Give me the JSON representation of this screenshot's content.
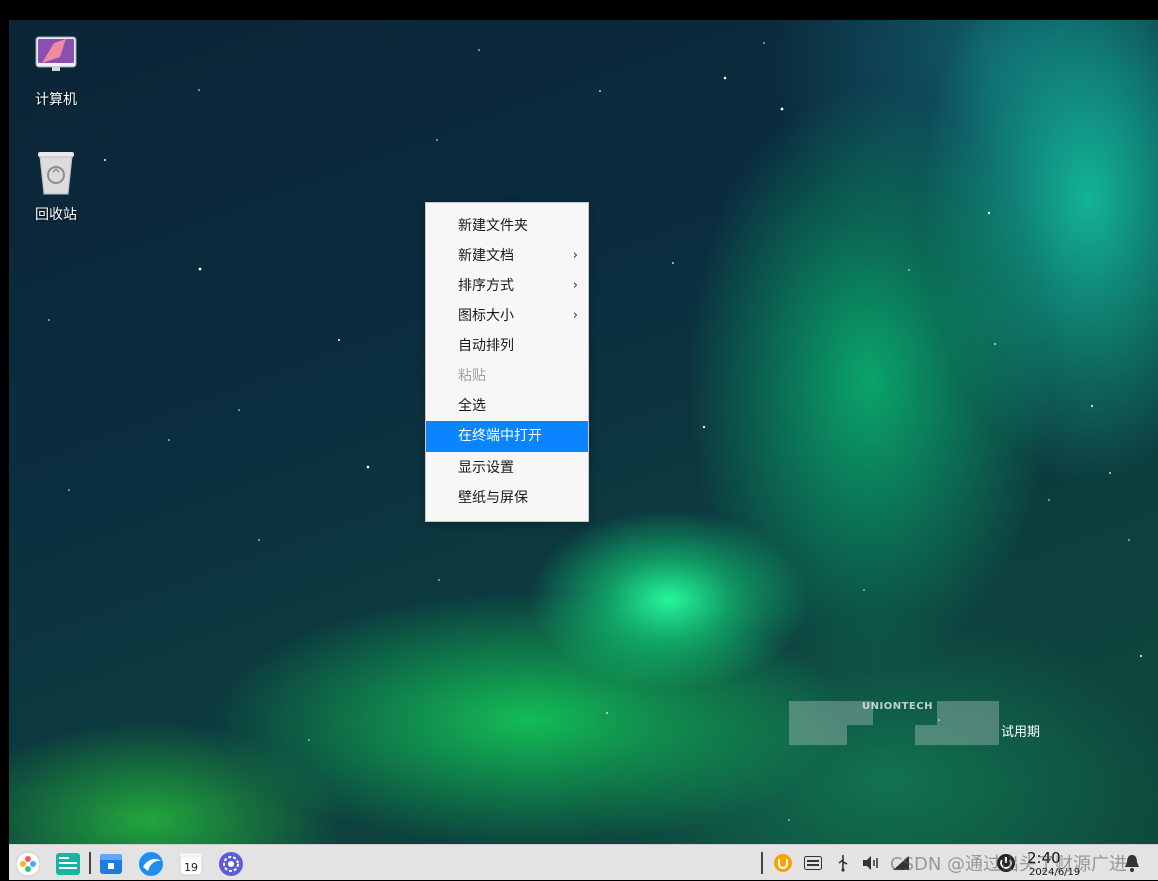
{
  "desktop": {
    "icons": [
      {
        "label": "计算机"
      },
      {
        "label": "回收站"
      }
    ]
  },
  "context_menu": {
    "items": [
      {
        "label": "新建文件夹"
      },
      {
        "label": "新建文档",
        "submenu": true
      },
      {
        "label": "排序方式",
        "submenu": true
      },
      {
        "label": "图标大小",
        "submenu": true
      },
      {
        "label": "自动排列"
      },
      {
        "label": "粘贴",
        "disabled": true
      },
      {
        "label": "全选"
      },
      {
        "label": "在终端中打开",
        "highlighted": true
      },
      {
        "label": "显示设置"
      },
      {
        "label": "壁纸与屏保"
      }
    ],
    "submenu_arrow": "›",
    "highlight_color": "#0a84ff"
  },
  "watermark": {
    "brand": "UNIONTECH",
    "trial_label": "试用期"
  },
  "taskbar": {
    "launcher_icons": [
      "launcher-icon",
      "multitask-view-icon",
      "file-manager-icon",
      "browser-icon",
      "calendar-icon",
      "settings-icon"
    ],
    "calendar_day": "19",
    "tray_icons": [
      "uos-id-icon",
      "keyboard-icon",
      "usb-icon",
      "volume-icon",
      "network-icon",
      "power-icon",
      "notification-icon"
    ],
    "clock": {
      "time": "2:40",
      "date": "2024/6/19"
    }
  },
  "overlay": {
    "csdn_watermark": "CSDN @通过出头了财源广进"
  }
}
